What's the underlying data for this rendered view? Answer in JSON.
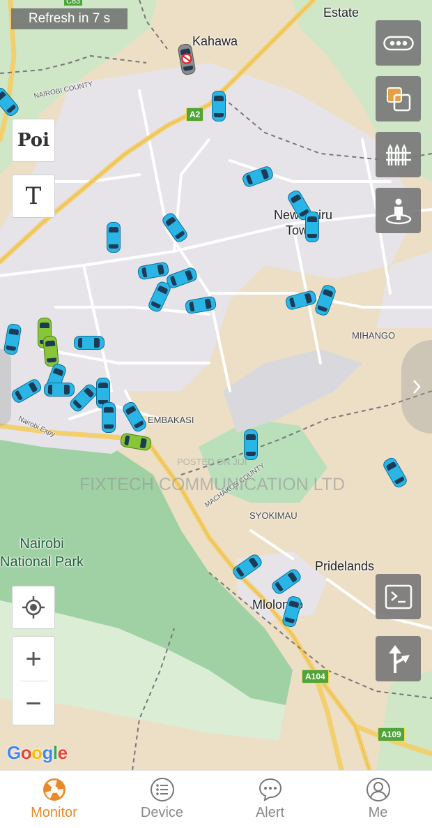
{
  "refresh": {
    "text": "Refresh in 7 s"
  },
  "map": {
    "labels": {
      "c63": "C63",
      "estate": "Estate",
      "kahawa": "Kahawa",
      "nairobi_county": "NAIROBI COUNTY",
      "new_ruiru_line1": "New Ruiru",
      "new_ruiru_line2": "Town",
      "mihango": "MIHANGO",
      "embakasi": "EMBAKASI",
      "nairobi_expy": "Nairobi Expy",
      "machakos_county": "MACHAKOS COUNTY",
      "syokimau": "SYOKIMAU",
      "park_line1": "Nairobi",
      "park_line2": "National Park",
      "pridelands": "Pridelands",
      "mlolongo": "Mlolongo"
    },
    "shields": {
      "a2": "A2",
      "a104": "A104",
      "a109": "A109"
    },
    "attribution": "Google"
  },
  "watermark": {
    "line1": "POSTED ON JIJI",
    "line2": "FIXTECH COMMUNICATION LTD"
  },
  "controls": {
    "poi_label": "Poi",
    "text_tool_label": "T",
    "zoom_in": "+",
    "zoom_out": "−",
    "right_buttons": [
      "more-icon",
      "layers-icon",
      "fence-icon",
      "street-view-icon",
      "command-icon",
      "route-icon"
    ]
  },
  "colors": {
    "vehicle_moving": "#29b6e6",
    "vehicle_idle": "#86c637",
    "vehicle_offline": "#8c8c8c",
    "active_tab": "#e88a2c",
    "inactive_tab": "#8a8a8a"
  },
  "vehicles": [
    {
      "status": "offline"
    },
    {
      "status": "moving"
    },
    {
      "status": "moving"
    },
    {
      "status": "moving"
    },
    {
      "status": "moving"
    },
    {
      "status": "moving"
    },
    {
      "status": "moving"
    },
    {
      "status": "moving"
    },
    {
      "status": "moving"
    },
    {
      "status": "moving"
    },
    {
      "status": "moving"
    },
    {
      "status": "moving"
    },
    {
      "status": "moving"
    },
    {
      "status": "moving"
    },
    {
      "status": "idle"
    },
    {
      "status": "idle"
    },
    {
      "status": "moving"
    },
    {
      "status": "moving"
    },
    {
      "status": "moving"
    },
    {
      "status": "moving"
    },
    {
      "status": "moving"
    },
    {
      "status": "moving"
    },
    {
      "status": "moving"
    },
    {
      "status": "moving"
    },
    {
      "status": "moving"
    },
    {
      "status": "idle"
    },
    {
      "status": "moving"
    },
    {
      "status": "moving"
    },
    {
      "status": "moving"
    },
    {
      "status": "moving"
    },
    {
      "status": "moving"
    },
    {
      "status": "moving"
    },
    {
      "status": "moving"
    },
    {
      "status": "moving"
    }
  ],
  "tabs": [
    {
      "label": "Monitor",
      "icon": "monitor-icon",
      "active": true
    },
    {
      "label": "Device",
      "icon": "device-list-icon",
      "active": false
    },
    {
      "label": "Alert",
      "icon": "alert-chat-icon",
      "active": false
    },
    {
      "label": "Me",
      "icon": "profile-icon",
      "active": false
    }
  ]
}
